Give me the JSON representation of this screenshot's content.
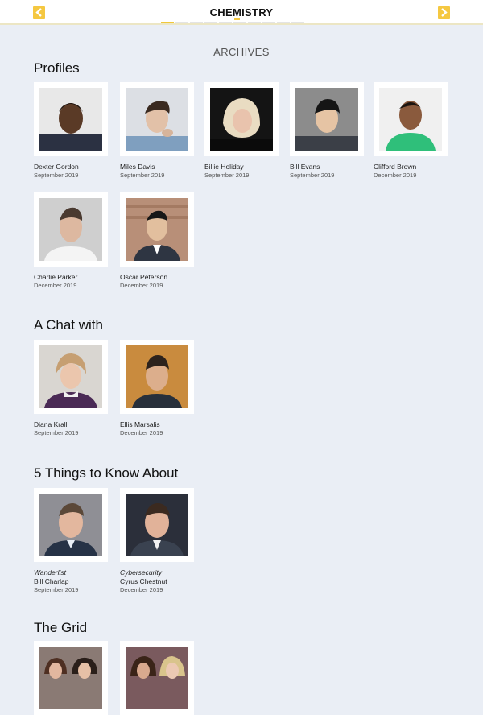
{
  "header": {
    "logo_text": "CHEMISTRY",
    "logo_parts": [
      "CHE",
      "M",
      "ISTRY"
    ],
    "accent_color": "#f5c841",
    "prev_icon": "chevron-left-icon",
    "next_icon": "chevron-right-icon",
    "page_indicator_count": 10,
    "page_indicator_active": 1
  },
  "page_title": "ARCHIVES",
  "sections": {
    "profiles": {
      "title": "Profiles",
      "items": [
        {
          "name": "Dexter Gordon",
          "date": "September 2019"
        },
        {
          "name": "Miles Davis",
          "date": "September 2019"
        },
        {
          "name": "Billie Holiday",
          "date": "September 2019"
        },
        {
          "name": "Bill Evans",
          "date": "September 2019"
        },
        {
          "name": "Clifford Brown",
          "date": "December 2019"
        },
        {
          "name": "Charlie Parker",
          "date": "December 2019"
        },
        {
          "name": "Oscar Peterson",
          "date": "December 2019"
        }
      ]
    },
    "chat": {
      "title": "A Chat with",
      "items": [
        {
          "name": "Diana Krall",
          "date": "September 2019"
        },
        {
          "name": "Ellis Marsalis",
          "date": "December 2019"
        }
      ]
    },
    "things": {
      "title": "5 Things to Know About",
      "items": [
        {
          "category": "Wanderlist",
          "name": "Bill Charlap",
          "date": "September 2019"
        },
        {
          "category": "Cybersecurity",
          "name": "Cyrus Chestnut",
          "date": "December 2019"
        }
      ]
    },
    "grid": {
      "title": "The Grid"
    }
  }
}
